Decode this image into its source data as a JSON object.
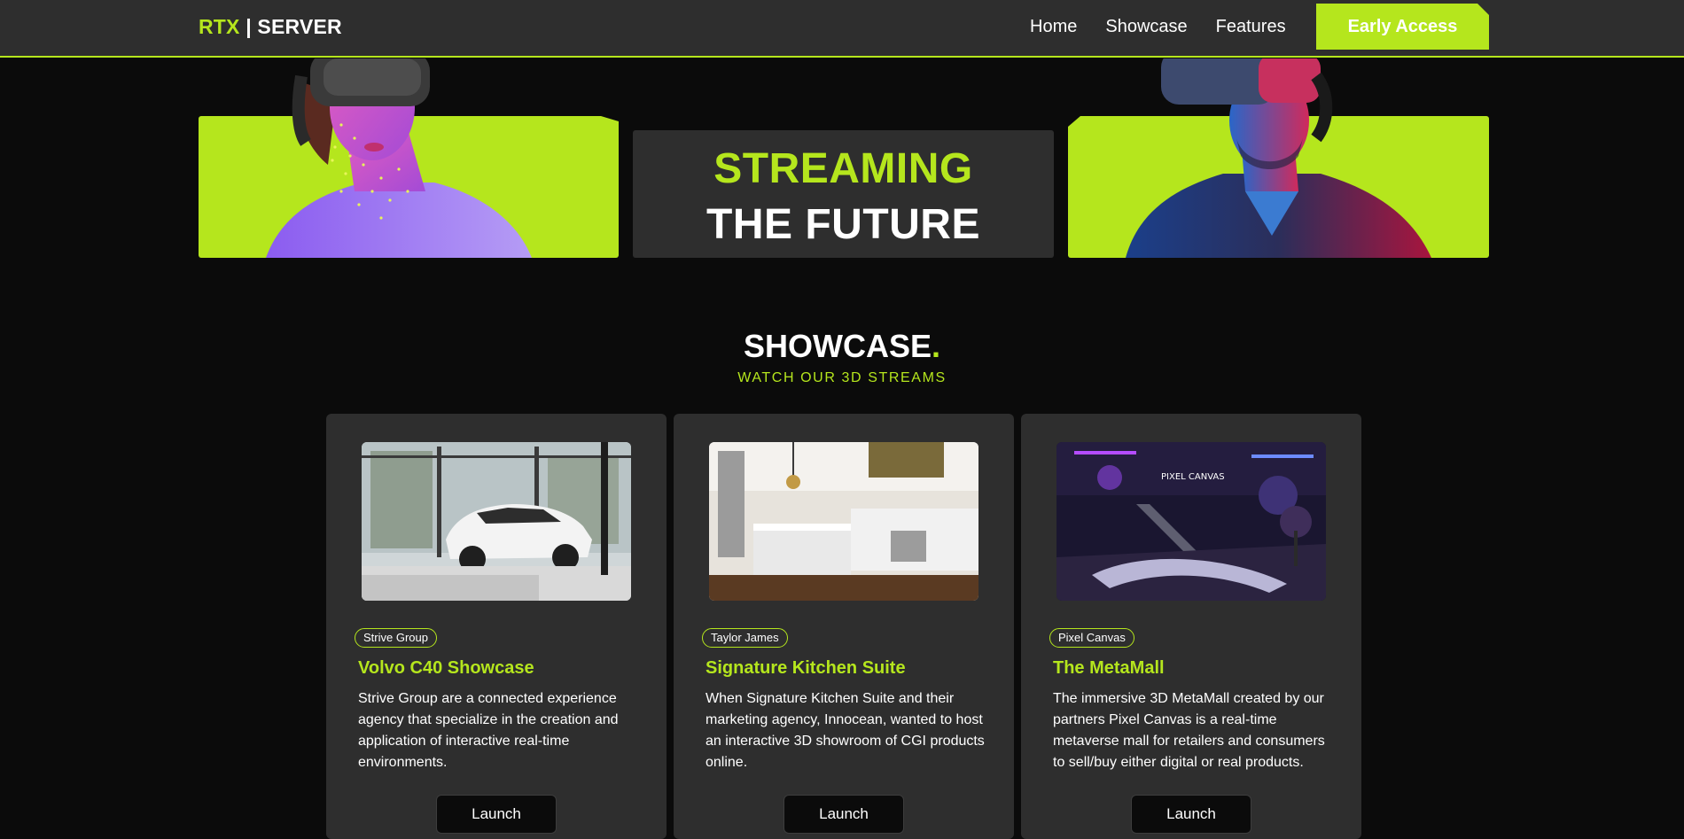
{
  "nav": {
    "logo_accent": "RTX",
    "logo_rest": " | SERVER",
    "links": [
      "Home",
      "Showcase",
      "Features"
    ],
    "cta": "Early Access"
  },
  "hero": {
    "line1": "STREAMING",
    "line2": "THE FUTURE"
  },
  "showcase": {
    "title": "SHOWCASE",
    "title_dot": ".",
    "subtitle": "WATCH OUR 3D STREAMS",
    "cards": [
      {
        "tag": "Strive Group",
        "title": "Volvo C40 Showcase",
        "description": "Strive Group are a connected experience agency that specialize in the creation and application of interactive real-time environments.",
        "button": "Launch"
      },
      {
        "tag": "Taylor James",
        "title": "Signature Kitchen Suite",
        "description": "When Signature Kitchen Suite and their marketing agency, Innocean, wanted to host an interactive 3D showroom of CGI products online.",
        "button": "Launch"
      },
      {
        "tag": "Pixel Canvas",
        "title": "The MetaMall",
        "description": "The immersive 3D MetaMall created by our partners Pixel Canvas is a real-time metaverse mall for retailers and consumers to sell/buy either digital or real products.",
        "button": "Launch",
        "image_sign": "PIXEL CANVAS"
      }
    ]
  },
  "colors": {
    "accent": "#b5e61d",
    "background": "#0b0b0b",
    "panel": "#2e2e2e"
  }
}
